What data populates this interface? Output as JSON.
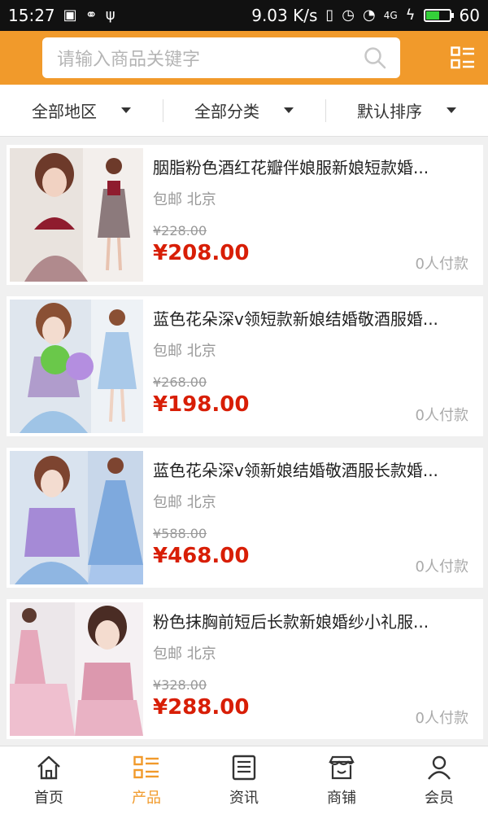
{
  "status_bar": {
    "time": "15:27",
    "speed": "9.03 K/s",
    "signal": "4G",
    "battery": "60",
    "battery_level": 0.6
  },
  "search": {
    "placeholder": "请输入商品关键字"
  },
  "filters": [
    {
      "label": "全部地区"
    },
    {
      "label": "全部分类"
    },
    {
      "label": "默认排序"
    }
  ],
  "products": [
    {
      "title": "胭脂粉色酒红花瓣伴娘服新娘短款婚...",
      "shipping": "包邮",
      "location": "北京",
      "old_price": "¥228.00",
      "new_price": "¥208.00",
      "sold": "0人付款"
    },
    {
      "title": "蓝色花朵深v领短款新娘结婚敬酒服婚...",
      "shipping": "包邮",
      "location": "北京",
      "old_price": "¥268.00",
      "new_price": "¥198.00",
      "sold": "0人付款"
    },
    {
      "title": "蓝色花朵深v领新娘结婚敬酒服长款婚...",
      "shipping": "包邮",
      "location": "北京",
      "old_price": "¥588.00",
      "new_price": "¥468.00",
      "sold": "0人付款"
    },
    {
      "title": "粉色抹胸前短后长款新娘婚纱小礼服...",
      "shipping": "包邮",
      "location": "北京",
      "old_price": "¥328.00",
      "new_price": "¥288.00",
      "sold": "0人付款"
    }
  ],
  "bottom_nav": [
    {
      "label": "首页",
      "icon": "home-icon"
    },
    {
      "label": "产品",
      "icon": "products-icon"
    },
    {
      "label": "资讯",
      "icon": "news-icon"
    },
    {
      "label": "商铺",
      "icon": "store-icon"
    },
    {
      "label": "会员",
      "icon": "member-icon"
    }
  ],
  "colors": {
    "accent": "#f19a2b",
    "price": "#d81e06"
  }
}
